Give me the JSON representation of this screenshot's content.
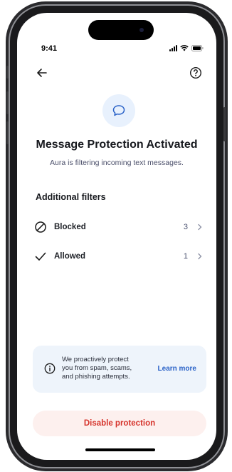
{
  "status": {
    "time": "9:41"
  },
  "header": {
    "back_icon": "arrow-left-icon",
    "help_icon": "question-circle-icon"
  },
  "hero": {
    "icon": "chat-bubble-icon",
    "title": "Message Protection Activated",
    "subtitle": "Aura is filtering incoming text messages."
  },
  "filters": {
    "heading": "Additional filters",
    "items": [
      {
        "icon": "blocked-icon",
        "label": "Blocked",
        "count": "3"
      },
      {
        "icon": "checkmark-icon",
        "label": "Allowed",
        "count": "1"
      }
    ]
  },
  "info": {
    "text": "We proactively protect you from spam, scams, and phishing attempts.",
    "link": "Learn more"
  },
  "actions": {
    "disable_label": "Disable protection"
  },
  "colors": {
    "accent": "#2b63c8",
    "danger": "#d6342c",
    "danger_bg": "#fdf0ee",
    "info_bg": "#eef4fb"
  }
}
